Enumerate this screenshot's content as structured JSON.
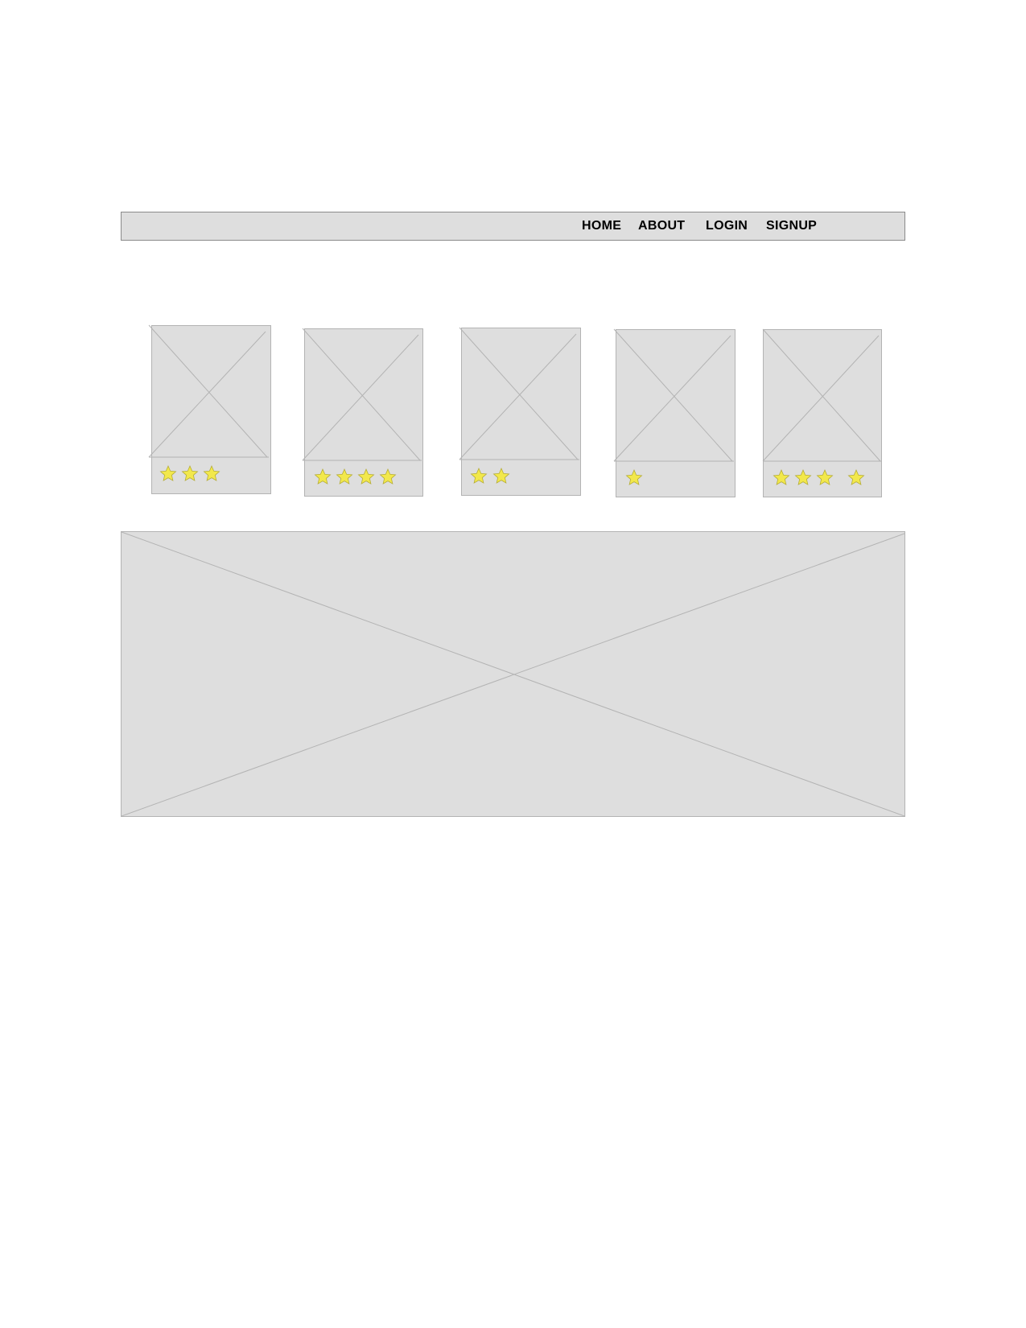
{
  "nav": {
    "items": [
      {
        "label": "HOME"
      },
      {
        "label": "ABOUT"
      },
      {
        "label": "LOGIN"
      },
      {
        "label": "SIGNUP"
      }
    ]
  },
  "cards": [
    {
      "rating": 3,
      "image": "image-placeholder"
    },
    {
      "rating": 4,
      "image": "image-placeholder"
    },
    {
      "rating": 2,
      "image": "image-placeholder"
    },
    {
      "rating": 1,
      "image": "image-placeholder"
    },
    {
      "rating": 4,
      "image": "image-placeholder"
    }
  ],
  "hero": {
    "image": "image-placeholder"
  },
  "colors": {
    "placeholder_fill": "#dedede",
    "placeholder_line": "#b3b3b3",
    "nav_border": "#8a8a8a",
    "star_fill": "#f2e84b",
    "star_stroke": "#b5ad38",
    "text": "#000000"
  }
}
